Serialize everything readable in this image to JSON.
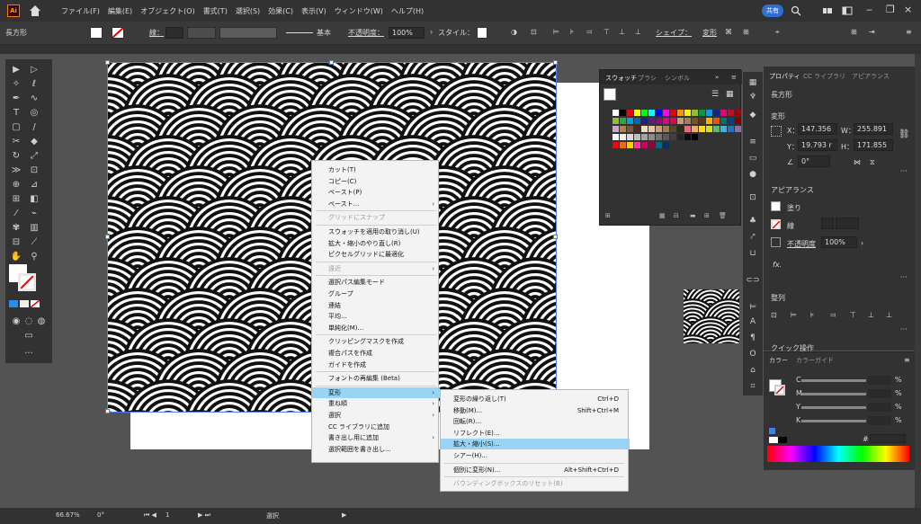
{
  "menubar": {
    "logo": "Ai",
    "items": [
      "ファイル(F)",
      "編集(E)",
      "オブジェクト(O)",
      "書式(T)",
      "選択(S)",
      "効果(C)",
      "表示(V)",
      "ウィンドウ(W)",
      "ヘルプ(H)"
    ],
    "share": "共有"
  },
  "control": {
    "object_type": "長方形",
    "stroke_label": "線：",
    "brush_label": "基本",
    "opacity_label": "不透明度：",
    "opacity_value": "100%",
    "style_label": "スタイル：",
    "shape_label": "シェイプ：",
    "transform_label": "変形"
  },
  "swatches": {
    "tabs": [
      "スウォッチ",
      "ブラシ",
      "シンボル"
    ]
  },
  "properties": {
    "tabs": [
      "プロパティ",
      "CC ライブラリ",
      "アピアランス"
    ],
    "object_type": "長方形",
    "transform_title": "変形",
    "x_label": "X：",
    "x_value": "147.356",
    "y_label": "Y：",
    "y_value": "19.793 r",
    "w_label": "W：",
    "w_value": "255.891",
    "h_label": "H：",
    "h_value": "171.855",
    "angle_value": "0°",
    "appearance_title": "アピアランス",
    "fill_label": "塗り",
    "stroke_label": "線",
    "opacity_label": "不透明度",
    "opacity_value": "100%",
    "fx_label": "fx.",
    "align_title": "整列",
    "quick_actions": "クイック操作"
  },
  "color_panel": {
    "tabs": [
      "カラー",
      "カラーガイド"
    ],
    "channels": [
      "C",
      "M",
      "Y",
      "K"
    ],
    "percent": "%",
    "hash": "#"
  },
  "context_menu": {
    "items": [
      {
        "label": "カット(T)",
        "disabled": false
      },
      {
        "label": "コピー(C)",
        "disabled": false
      },
      {
        "label": "ペースト(P)",
        "disabled": false
      },
      {
        "label": "ペースト...",
        "disabled": false,
        "submenu": true
      },
      {
        "label": "グリッドにスナップ",
        "disabled": true
      },
      {
        "label": "スウォッチを適用の取り消し(U)",
        "disabled": false
      },
      {
        "label": "拡大・縮小のやり直し(R)",
        "disabled": false
      },
      {
        "label": "ピクセルグリッドに最適化",
        "disabled": false
      },
      {
        "label": "遠近",
        "disabled": true,
        "submenu": true
      },
      {
        "label": "選択パス編集モード",
        "disabled": false
      },
      {
        "label": "グループ",
        "disabled": false
      },
      {
        "label": "連結",
        "disabled": false
      },
      {
        "label": "平均...",
        "disabled": false
      },
      {
        "label": "単純化(M)...",
        "disabled": false
      },
      {
        "label": "クリッピングマスクを作成",
        "disabled": false
      },
      {
        "label": "複合パスを作成",
        "disabled": false
      },
      {
        "label": "ガイドを作成",
        "disabled": false
      },
      {
        "label": "フォントの再編集 (Beta)",
        "disabled": false
      },
      {
        "label": "変形",
        "disabled": false,
        "submenu": true,
        "highlighted": true
      },
      {
        "label": "重ね順",
        "disabled": false,
        "submenu": true
      },
      {
        "label": "選択",
        "disabled": false,
        "submenu": true
      },
      {
        "label": "CC ライブラリに追加",
        "disabled": false
      },
      {
        "label": "書き出し用に追加",
        "disabled": false,
        "submenu": true
      },
      {
        "label": "選択範囲を書き出し...",
        "disabled": false
      }
    ]
  },
  "submenu": {
    "items": [
      {
        "label": "変形の繰り返し(T)",
        "shortcut": "Ctrl+D"
      },
      {
        "label": "移動(M)...",
        "shortcut": "Shift+Ctrl+M"
      },
      {
        "label": "回転(R)...",
        "shortcut": ""
      },
      {
        "label": "リフレクト(E)...",
        "shortcut": ""
      },
      {
        "label": "拡大・縮小(S)...",
        "shortcut": "",
        "highlighted": true
      },
      {
        "label": "シアー(H)...",
        "shortcut": ""
      },
      {
        "label": "個別に変形(N)...",
        "shortcut": "Alt+Shift+Ctrl+D"
      },
      {
        "label": "バウンディングボックスのリセット(B)",
        "shortcut": "",
        "disabled": true
      }
    ]
  },
  "status": {
    "zoom": "66.67%",
    "angle": "0°",
    "artboard": "1",
    "tool": "選択"
  },
  "colors": {
    "accent": "#99d4f4",
    "share": "#2f6ed6",
    "selection": "#4f7fff"
  }
}
